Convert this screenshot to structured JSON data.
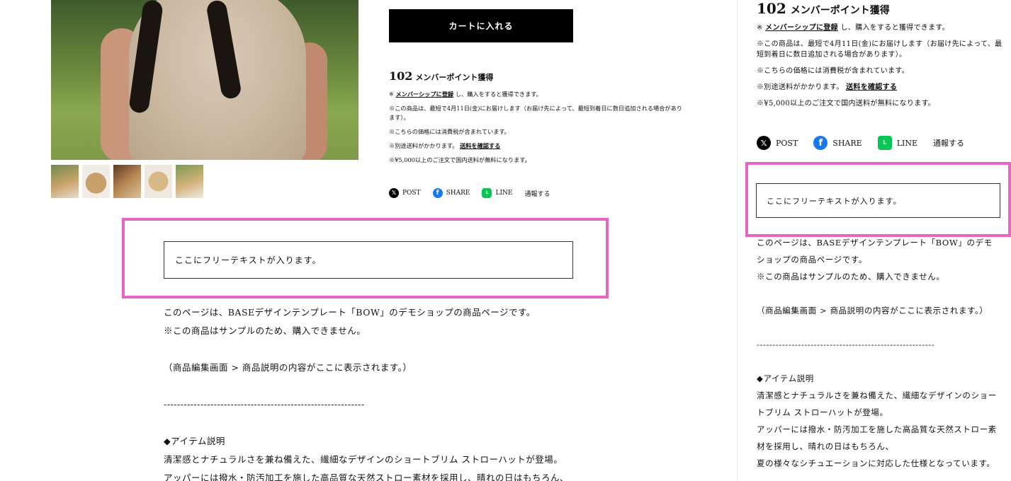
{
  "product": {
    "cart_button": "カートに入れる",
    "thumbnails": [
      "thumb-1",
      "thumb-2",
      "thumb-3",
      "thumb-4",
      "thumb-5"
    ]
  },
  "points": {
    "number": "102",
    "label": "メンバーポイント獲得"
  },
  "notes": {
    "member_pre": "※",
    "member_link": "メンバーシップに登録",
    "member_post": "し、購入をすると獲得できます。",
    "delivery_left": "※この商品は、最短で4月11日(金)にお届けします（お届け先によって、最短到着日に数日追加される場合があります）。",
    "delivery_right": "※この商品は、最短で4月11日(金)にお届けします（お届け先によって、最短到着日に数日追加される場合があります）。",
    "tax": "※こちらの価格には消費税が含まれています。",
    "shipping_pre": "※別途送料がかかります。",
    "shipping_link": "送料を確認する",
    "free_shipping": "※¥5,000以上のご注文で国内送料が無料になります。"
  },
  "share": {
    "x_label": "POST",
    "facebook_label": "SHARE",
    "line_label": "LINE",
    "report_label": "通報する"
  },
  "free_text": "ここにフリーテキストが入ります。",
  "description": {
    "line1_left": "このページは、BASEデザインテンプレート「BOW」のデモショップの商品ページです。",
    "line1_right_a": "このページは、BASEデザインテンプレート「BOW」のデモ",
    "line1_right_b": "ショップの商品ページです。",
    "line2": "※この商品はサンプルのため、購入できません。",
    "line3": "（商品編集画面 > 商品説明の内容がここに表示されます。）",
    "separator_left": "------------------------------------------------------------",
    "separator_right": "--------------------------------------------------------",
    "item_heading": "◆アイテム説明",
    "item_left_1": "清潔感とナチュラルさを兼ね備えた、繊細なデザインのショートブリム ストローハットが登場。",
    "item_left_2": "アッパーには撥水・防汚加工を施した高品質な天然ストロー素材を採用し、晴れの日はもちろん、",
    "item_right_1": "清潔感とナチュラルさを兼ね備えた、繊細なデザインのショー",
    "item_right_2": "トブリム ストローハットが登場。",
    "item_right_3": "アッパーには撥水・防汚加工を施した高品質な天然ストロー素",
    "item_right_4": "材を採用し、晴れの日はもちろん、",
    "item_right_5": "夏の様々なシチュエーションに対応した仕様となっています。"
  },
  "colors": {
    "highlight": "#e865c4",
    "facebook": "#1877f2",
    "line": "#06c755"
  },
  "icons": [
    "x-icon",
    "facebook-icon",
    "line-icon"
  ]
}
